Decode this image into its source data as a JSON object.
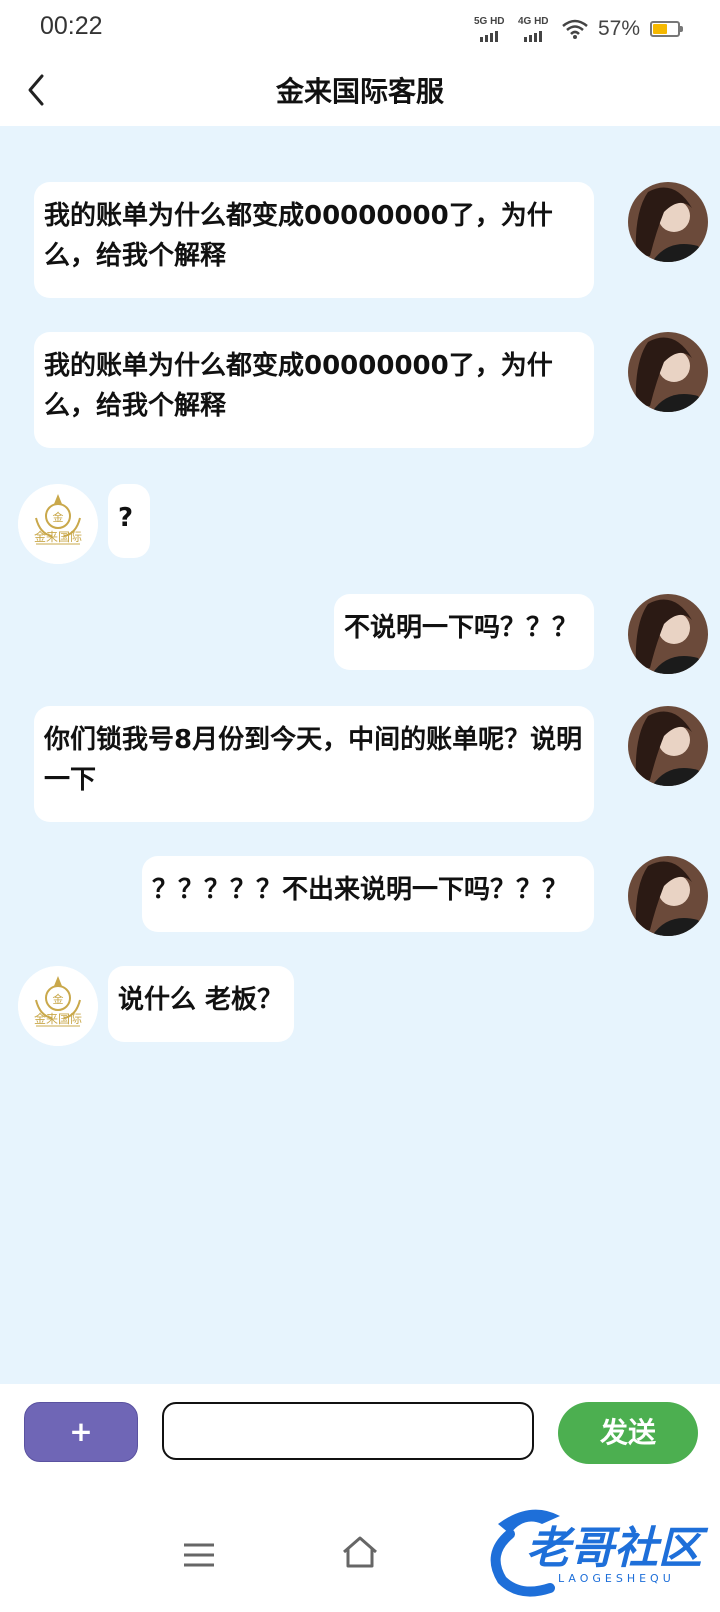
{
  "status_bar": {
    "time": "00:22",
    "network1": "5G HD",
    "network2": "4G HD",
    "battery": "57%",
    "battery_level": 0.57
  },
  "header": {
    "title": "金来国际客服"
  },
  "messages": [
    {
      "sender": "user",
      "text": "我的账单为什么都变成00000000了，为什么，给我个解释"
    },
    {
      "sender": "user",
      "text": "我的账单为什么都变成00000000了，为什么，给我个解释"
    },
    {
      "sender": "agent",
      "text": "?"
    },
    {
      "sender": "user",
      "text": "不说明一下吗？？？"
    },
    {
      "sender": "user",
      "text": "你们锁我号8月份到今天，中间的账单呢？说明一下"
    },
    {
      "sender": "user",
      "text": "？？？？？不出来说明一下吗？？？"
    },
    {
      "sender": "agent",
      "text": "说什么 老板？"
    }
  ],
  "agent_logo_text": "金来国际",
  "input_bar": {
    "plus_label": "+",
    "input_value": "",
    "send_label": "发送"
  },
  "watermark": {
    "title": "老哥社区",
    "subtitle": "LAOGESHEQU"
  },
  "colors": {
    "chat_bg": "#e7f4fd",
    "plus_button": "#6f66b6",
    "send_button": "#4caf50",
    "watermark_blue": "#1e6fd9"
  },
  "icons": {
    "back": "chevron-left-icon",
    "menu": "menu-icon",
    "home": "home-icon"
  }
}
